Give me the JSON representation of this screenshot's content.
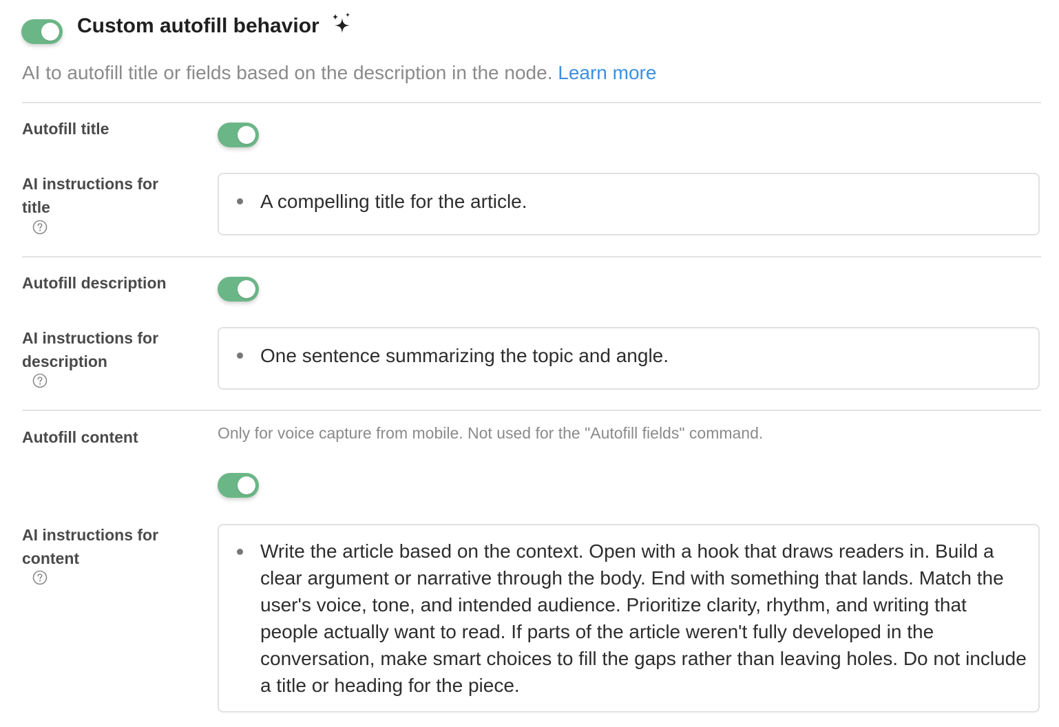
{
  "header": {
    "title": "Custom autofill behavior",
    "enabled": true,
    "sparkle_icon": "sparkle-icon",
    "description": "AI to autofill title or fields based on the description in the node.",
    "learn_more": "Learn more"
  },
  "colors": {
    "toggle_on": "#6bb687",
    "link": "#3d8fe0",
    "muted_text": "#8a8a8a",
    "divider": "#e2e2e2"
  },
  "title_section": {
    "toggle_label": "Autofill title",
    "enabled": true,
    "instructions_label": "AI instructions for title",
    "instructions": "A compelling title for the article."
  },
  "description_section": {
    "toggle_label": "Autofill description",
    "enabled": true,
    "instructions_label": "AI instructions for description",
    "instructions": "One sentence summarizing the topic and angle."
  },
  "content_section": {
    "toggle_label": "Autofill content",
    "note": "Only for voice capture from mobile. Not used for the \"Autofill fields\" command.",
    "enabled": true,
    "instructions_label": "AI instructions for content",
    "instructions": "Write the article based on the context. Open with a hook that draws readers in. Build a clear argument or narrative through the body. End with something that lands. Match the user's voice, tone, and intended audience. Prioritize clarity, rhythm, and writing that people actually want to read. If parts of the article weren't fully developed in the conversation, make smart choices to fill the gaps rather than leaving holes. Do not include a title or heading for the piece."
  }
}
